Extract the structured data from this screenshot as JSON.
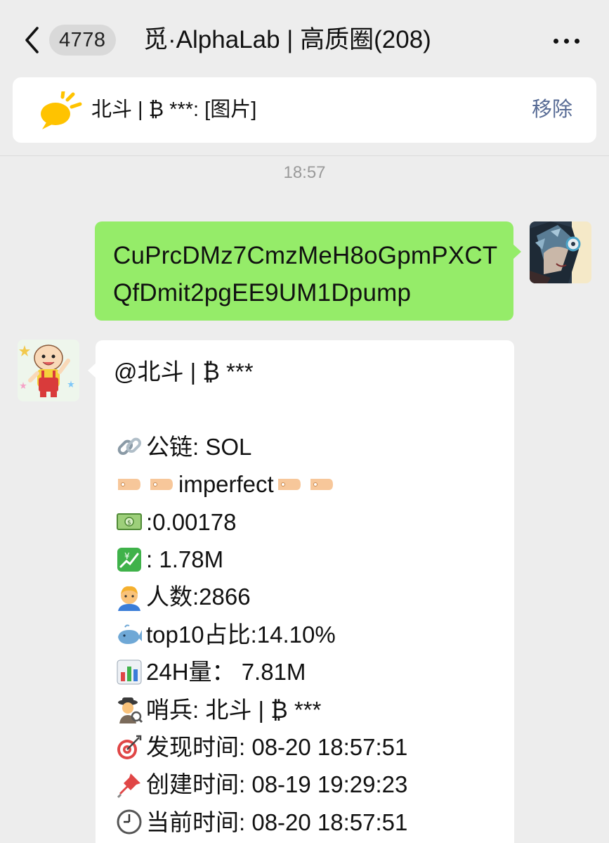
{
  "header": {
    "back_icon": "chevron-left-icon",
    "unread_count": "4778",
    "title": "觅·AlphaLab | 高质圈(208)",
    "more_icon": "more-dots-icon"
  },
  "pinned": {
    "icon": "megaphone-icon",
    "text": "北斗 | ₿ ***: [图片]",
    "remove_label": "移除"
  },
  "timestamp": "18:57",
  "messages": {
    "sent": {
      "avatar": "wolf-warrior-avatar",
      "text": "CuPrcDMz7CmzMeH8oGpmPXCTQfDmit2pgEE9UM1Dpump"
    },
    "received": {
      "avatar": "cartoon-baby-avatar",
      "mention": "@北斗 | ₿ ***",
      "chain": "公链: SOL",
      "tag_text": "imperfect",
      "price": ":0.00178",
      "market_cap": ": 1.78M",
      "holders": "人数:2866",
      "top10": "top10占比:14.10%",
      "volume": "24H量：  7.81M",
      "scout": "哨兵: 北斗 | ₿ ***",
      "found_time": "发现时间: 08-20 18:57:51",
      "created_time": "创建时间: 08-19 19:29:23",
      "current_time": "当前时间: 08-20 18:57:51"
    }
  },
  "colors": {
    "background": "#ededed",
    "sent_bubble": "#95ec69",
    "received_bubble": "#ffffff",
    "link_blue": "#576b95",
    "timestamp_gray": "#9a9a9a"
  }
}
